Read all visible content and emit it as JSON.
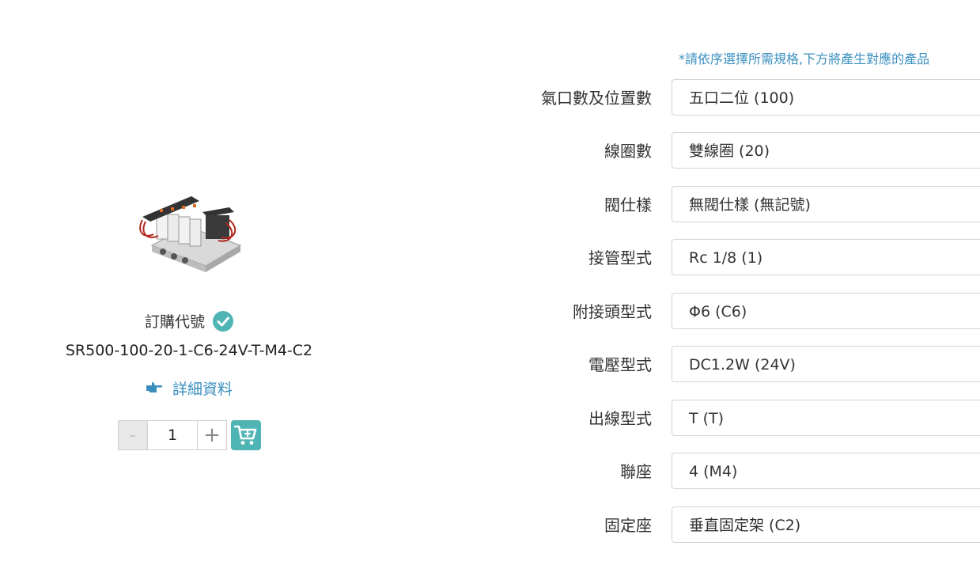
{
  "product": {
    "order_code_label": "訂購代號",
    "order_code": "SR500-100-20-1-C6-24V-T-M4-C2",
    "details_link": "詳細資料",
    "quantity": "1",
    "minus_label": "-",
    "plus_label": "+"
  },
  "spec": {
    "note": "*請依序選擇所需規格,下方將產生對應的產品",
    "rows": [
      {
        "label": "氣口數及位置數",
        "value": "五口二位 (100)"
      },
      {
        "label": "線圈數",
        "value": "雙線圈 (20)"
      },
      {
        "label": "閥仕樣",
        "value": "無閥仕樣 (無記號)"
      },
      {
        "label": "接管型式",
        "value": "Rc 1/8 (1)"
      },
      {
        "label": "附接頭型式",
        "value": "Φ6 (C6)"
      },
      {
        "label": "電壓型式",
        "value": "DC1.2W (24V)"
      },
      {
        "label": "出線型式",
        "value": "T (T)"
      },
      {
        "label": "聯座",
        "value": "4 (M4)"
      },
      {
        "label": "固定座",
        "value": "垂直固定架 (C2)"
      }
    ]
  },
  "colors": {
    "accent": "#4fb4b4",
    "link": "#3a8fc0"
  }
}
